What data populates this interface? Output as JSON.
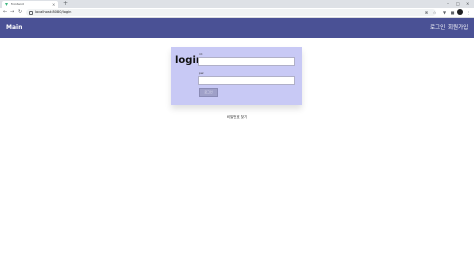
{
  "browser": {
    "tab_title": "frontend",
    "tab_close": "×",
    "new_tab": "+",
    "window_controls": [
      "–",
      "□",
      "×"
    ],
    "nav": {
      "back": "←",
      "forward": "→",
      "reload": "↻"
    },
    "url": "localhost:8080/login"
  },
  "header": {
    "brand": "Main",
    "login_link": "로그인",
    "signup_link": "회원가입"
  },
  "login": {
    "title": "login",
    "id_label": "id:",
    "pw_label": "pw:",
    "submit": "로그인"
  },
  "footer": {
    "find_password": "비밀번호 찾기"
  }
}
